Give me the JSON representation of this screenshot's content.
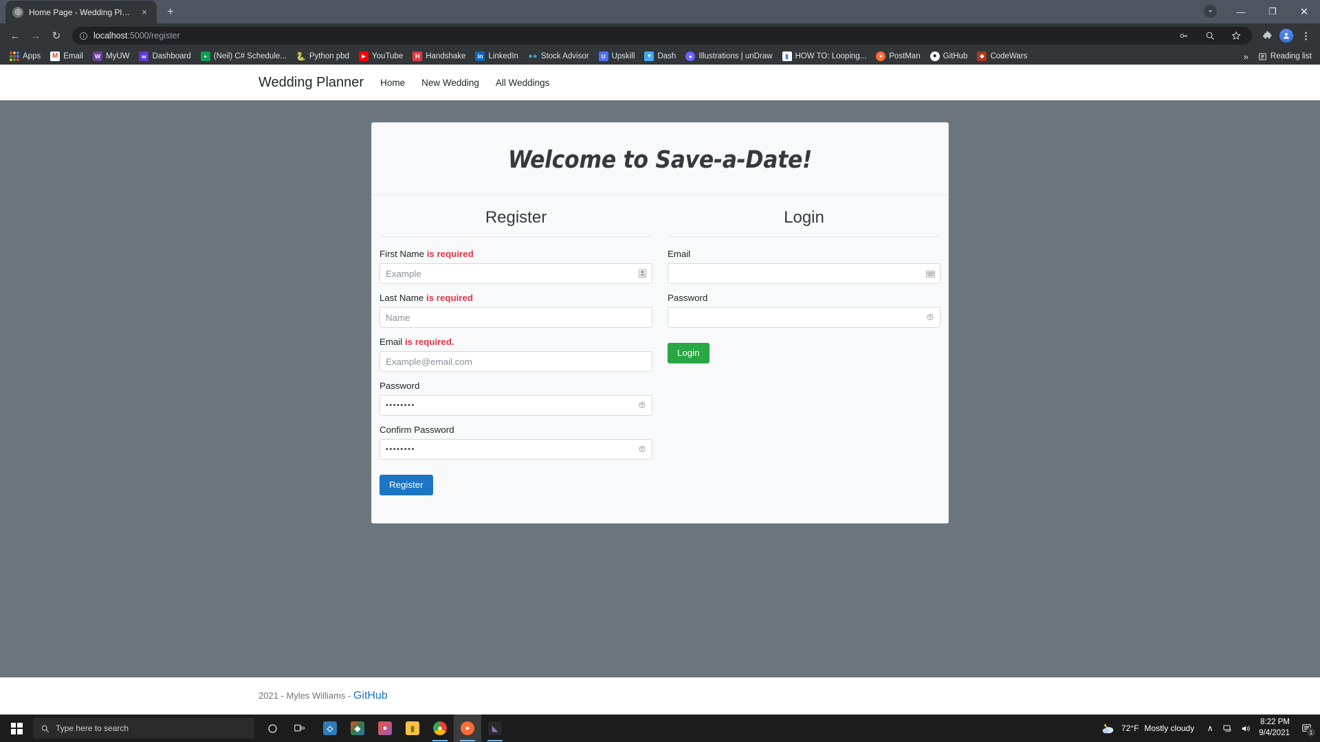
{
  "browser": {
    "tab": {
      "title": "Home Page - Wedding Planner",
      "favicon": "globe-icon",
      "close": "×"
    },
    "new_tab_label": "+",
    "window_controls": {
      "minimize": "—",
      "maximize": "❐",
      "close": "✕"
    },
    "nav": {
      "back": "←",
      "forward": "→",
      "reload": "↻"
    },
    "omnibox": {
      "url_host": "localhost",
      "url_path": ":5000/register",
      "info_icon": "info-circle-icon"
    },
    "toolbar_icons": [
      "key-icon",
      "search-icon",
      "star-icon",
      "extensions-icon",
      "profile-avatar",
      "menu-kebab-icon"
    ],
    "bookmarks": [
      {
        "label": "Apps",
        "icon": "apps-grid-icon",
        "color": "#ea4335"
      },
      {
        "label": "Email",
        "icon": "gmail-icon",
        "color": "#ea4335"
      },
      {
        "label": "MyUW",
        "icon": "uw-icon",
        "color": "#6b3fa0"
      },
      {
        "label": "Dashboard",
        "icon": "dashboard-icon",
        "color": "#5b3bd4"
      },
      {
        "label": "(Neil) C# Schedule...",
        "icon": "sheets-icon",
        "color": "#0f9d58"
      },
      {
        "label": "Python pbd",
        "icon": "python-icon",
        "color": "#3776ab"
      },
      {
        "label": "YouTube",
        "icon": "youtube-icon",
        "color": "#ff0000"
      },
      {
        "label": "Handshake",
        "icon": "handshake-icon",
        "color": "#e0393e"
      },
      {
        "label": "LinkedIn",
        "icon": "linkedin-icon",
        "color": "#0a66c2"
      },
      {
        "label": "Stock Advisor",
        "icon": "stock-icon",
        "color": "#2aa5c7"
      },
      {
        "label": "Upskill",
        "icon": "upskill-icon",
        "color": "#4c6ef5"
      },
      {
        "label": "Dash",
        "icon": "dash-icon",
        "color": "#3fa9f5"
      },
      {
        "label": "Illustrations | unDraw",
        "icon": "undraw-icon",
        "color": "#6c63ff"
      },
      {
        "label": "HOW TO: Looping...",
        "icon": "doc-icon",
        "color": "#4285f4"
      },
      {
        "label": "PostMan",
        "icon": "postman-icon",
        "color": "#ff6c37"
      },
      {
        "label": "GitHub",
        "icon": "github-icon",
        "color": "#24292e"
      },
      {
        "label": "CodeWars",
        "icon": "codewars-icon",
        "color": "#b1361e"
      }
    ],
    "bookmarks_overflow": "»",
    "reading_list": {
      "label": "Reading list",
      "icon": "reading-list-icon"
    }
  },
  "site": {
    "brand": "Wedding Planner",
    "nav_links": [
      {
        "label": "Home"
      },
      {
        "label": "New Wedding"
      },
      {
        "label": "All Weddings"
      }
    ]
  },
  "card": {
    "title": "Welcome to Save-a-Date!",
    "register": {
      "heading": "Register",
      "fields": [
        {
          "label": "First Name ",
          "required_text": "is required",
          "placeholder": "Example",
          "value": "",
          "type": "text",
          "icon": "autofill-card-icon",
          "name": "first-name"
        },
        {
          "label": "Last Name ",
          "required_text": "is required",
          "placeholder": "Name",
          "value": "",
          "type": "text",
          "icon": "",
          "name": "last-name"
        },
        {
          "label": "Email ",
          "required_text": "is required.",
          "placeholder": "Example@email.com",
          "value": "",
          "type": "text",
          "icon": "",
          "name": "email"
        },
        {
          "label": "Password",
          "required_text": "",
          "placeholder": "",
          "value": "••••••••",
          "type": "password",
          "icon": "reveal-password-icon",
          "name": "password"
        },
        {
          "label": "Confirm Password",
          "required_text": "",
          "placeholder": "",
          "value": "••••••••",
          "type": "password",
          "icon": "reveal-password-icon",
          "name": "confirm-password"
        }
      ],
      "submit_label": "Register",
      "submit_color": "#1c74c4"
    },
    "login": {
      "heading": "Login",
      "fields": [
        {
          "label": "Email",
          "required_text": "",
          "placeholder": "",
          "value": "",
          "type": "text",
          "icon": "autofill-keyboard-icon",
          "name": "login-email"
        },
        {
          "label": "Password",
          "required_text": "",
          "placeholder": "",
          "value": "",
          "type": "password",
          "icon": "reveal-password-icon",
          "name": "login-password"
        }
      ],
      "submit_label": "Login",
      "submit_color": "#28a745"
    }
  },
  "footer": {
    "text": "2021 - Myles Williams - ",
    "link": "GitHub"
  },
  "taskbar": {
    "search_placeholder": "Type here to search",
    "cortana_icon": "cortana-circle-icon",
    "taskview_icon": "task-view-icon",
    "apps": [
      {
        "name": "vscode",
        "label": "⬡",
        "color": "#2f7cb8"
      },
      {
        "name": "unknown-color-app",
        "label": "◆",
        "color": "#2d7d46"
      },
      {
        "name": "paint-3d",
        "label": "●",
        "color": "#8b5bb5"
      },
      {
        "name": "file-explorer",
        "label": "▬",
        "color": "#f5c344"
      },
      {
        "name": "chrome",
        "label": "●",
        "color": "#4285f4"
      },
      {
        "name": "postman",
        "label": "●",
        "color": "#ff6c37"
      },
      {
        "name": "visual-studio",
        "label": "◤",
        "color": "#5c2d91"
      }
    ],
    "weather": {
      "temp": "72°F",
      "condition": "Mostly cloudy",
      "icon": "partly-cloudy-night-icon"
    },
    "tray": {
      "chevron": "∧",
      "network_icon": "network-icon",
      "volume_icon": "volume-icon"
    },
    "clock": {
      "time": "8:22 PM",
      "date": "9/4/2021"
    },
    "notifications": {
      "icon": "notification-icon",
      "count": "1"
    }
  }
}
